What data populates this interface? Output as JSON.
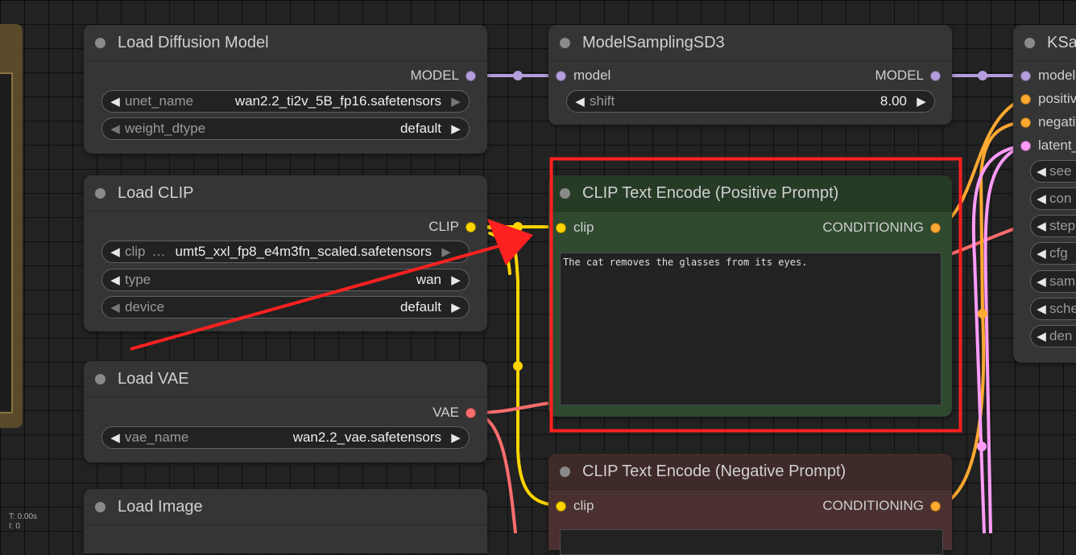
{
  "nodes": {
    "load_diffusion_model": {
      "title": "Load Diffusion Model",
      "output": "MODEL",
      "widgets": [
        {
          "label": "unet_name",
          "value": "wan2.2_ti2v_5B_fp16.safetensors"
        },
        {
          "label": "weight_dtype",
          "value": "default"
        }
      ]
    },
    "model_sampling": {
      "title": "ModelSamplingSD3",
      "input": "model",
      "output": "MODEL",
      "widgets": [
        {
          "label": "shift",
          "value": "8.00"
        }
      ]
    },
    "ksampler": {
      "title": "KSa",
      "inputs": [
        "model",
        "positiv",
        "negativ",
        "latent_"
      ],
      "widgets": [
        "see",
        "con",
        "step",
        "cfg",
        "sam",
        "sche",
        "den"
      ]
    },
    "load_clip": {
      "title": "Load CLIP",
      "output": "CLIP",
      "widgets": [
        {
          "label": "clip",
          "ellipsis": "…",
          "value": "umt5_xxl_fp8_e4m3fn_scaled.safetensors"
        },
        {
          "label": "type",
          "value": "wan"
        },
        {
          "label": "device",
          "value": "default"
        }
      ]
    },
    "clip_positive": {
      "title": "CLIP Text Encode (Positive Prompt)",
      "input": "clip",
      "output": "CONDITIONING",
      "text": "The cat removes the glasses from its eyes."
    },
    "load_vae": {
      "title": "Load VAE",
      "output": "VAE",
      "widgets": [
        {
          "label": "vae_name",
          "value": "wan2.2_vae.safetensors"
        }
      ]
    },
    "clip_negative": {
      "title": "CLIP Text Encode (Negative Prompt)",
      "input": "clip",
      "output": "CONDITIONING"
    },
    "load_image": {
      "title": "Load Image"
    }
  },
  "stats": {
    "time": "T: 0.00s",
    "line2": "I: 0"
  },
  "colors": {
    "model": "#b39ddb",
    "clip": "#ffd500",
    "conditioning": "#ffa931",
    "vae": "#ff6e6e",
    "latent": "#ff9cf9",
    "highlight": "#ff2020",
    "positive_bg": "#2f4a2f",
    "positive_title": "#263b26",
    "negative_title": "#3f2a2a"
  }
}
